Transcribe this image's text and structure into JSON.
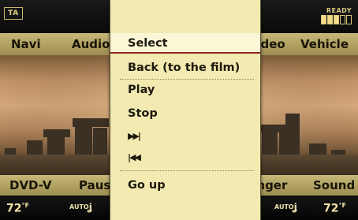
{
  "status": {
    "ta_label": "TA",
    "ready_label": "READY"
  },
  "main_menu": {
    "left1": "Navi",
    "left2": "Audio",
    "right1": "Video",
    "right2": "Vehicle"
  },
  "function_bar": {
    "left1": "DVD-V",
    "left2": "Pause",
    "right1": "Finger",
    "right2": "Sound"
  },
  "climate": {
    "left_temp": "72",
    "right_temp": "72",
    "unit": "°F",
    "auto_label": "AUTO"
  },
  "overlay_menu": {
    "items": [
      {
        "label": "Select",
        "selected": true
      },
      {
        "label": "Back (to the film)"
      },
      {
        "label": "Play"
      },
      {
        "label": "Stop"
      },
      {
        "label": "▶▶|",
        "icon": "next-track-icon"
      },
      {
        "label": "|◀◀",
        "icon": "previous-track-icon"
      },
      {
        "label": "Go up"
      }
    ]
  },
  "colors": {
    "menu_bar": "#b3a364",
    "panel": "#f3eab2",
    "selection_underline": "#8a2a1c",
    "text": "#1c1a0e"
  }
}
